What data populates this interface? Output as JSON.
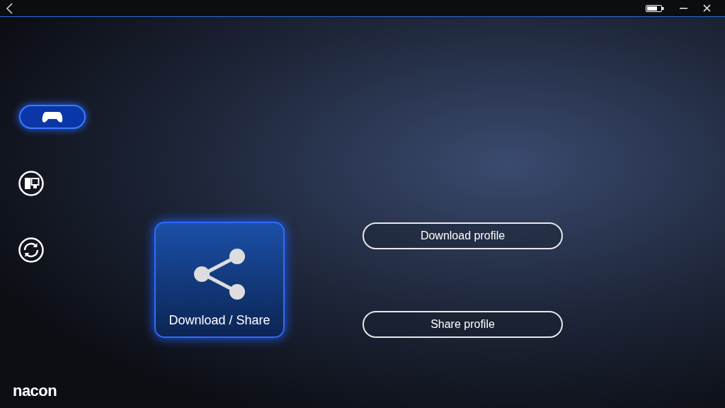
{
  "sidebar": {
    "items": [
      {
        "kind": "console",
        "selected": true
      },
      {
        "kind": "pc",
        "selected": false
      },
      {
        "kind": "sync",
        "selected": false
      }
    ]
  },
  "tile": {
    "label": "Download / Share"
  },
  "buttons": [
    {
      "label": "Download profile"
    },
    {
      "label": "Share profile"
    }
  ],
  "brand": {
    "logo": "nacon"
  }
}
